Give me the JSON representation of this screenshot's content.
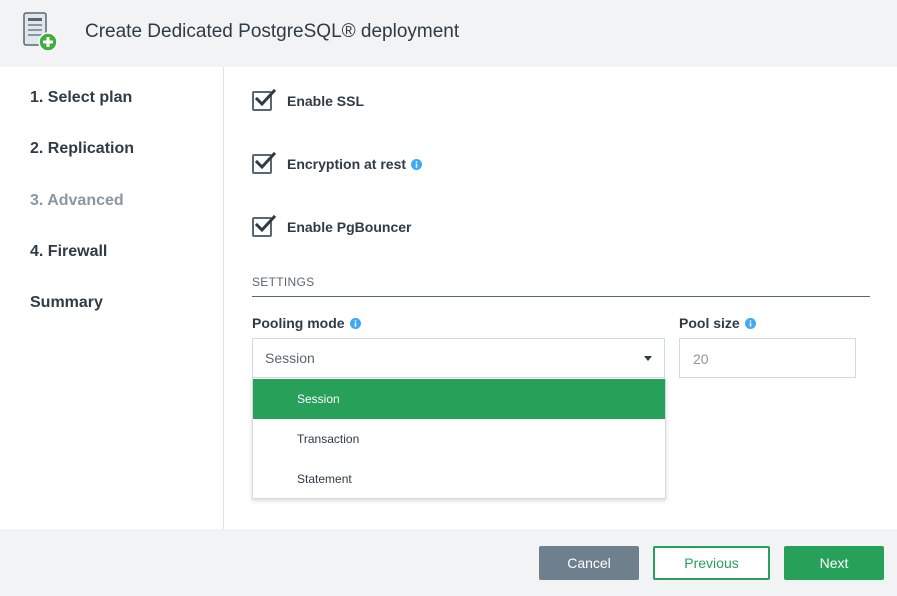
{
  "header": {
    "title": "Create Dedicated PostgreSQL® deployment",
    "icon": "server-add-icon"
  },
  "sidebar": {
    "steps": [
      {
        "label": "1. Select plan"
      },
      {
        "label": "2. Replication"
      },
      {
        "label": "3. Advanced",
        "current": true
      },
      {
        "label": "4. Firewall"
      },
      {
        "label": "Summary"
      }
    ]
  },
  "options": {
    "ssl": {
      "label": "Enable SSL",
      "checked": true
    },
    "encryption": {
      "label": "Encryption at rest",
      "checked": true,
      "info": true
    },
    "pgbouncer": {
      "label": "Enable PgBouncer",
      "checked": true
    }
  },
  "settings": {
    "heading": "SETTINGS",
    "pooling_mode": {
      "label": "Pooling mode",
      "value": "Session",
      "options": [
        "Session",
        "Transaction",
        "Statement"
      ],
      "selected_index": 0
    },
    "pool_size": {
      "label": "Pool size",
      "value": "20"
    }
  },
  "footer": {
    "cancel": "Cancel",
    "previous": "Previous",
    "next": "Next"
  },
  "colors": {
    "accent": "#27a05a",
    "info": "#3fa9f5",
    "cancel": "#6e7f8d",
    "muted_step": "#8b97a0"
  }
}
